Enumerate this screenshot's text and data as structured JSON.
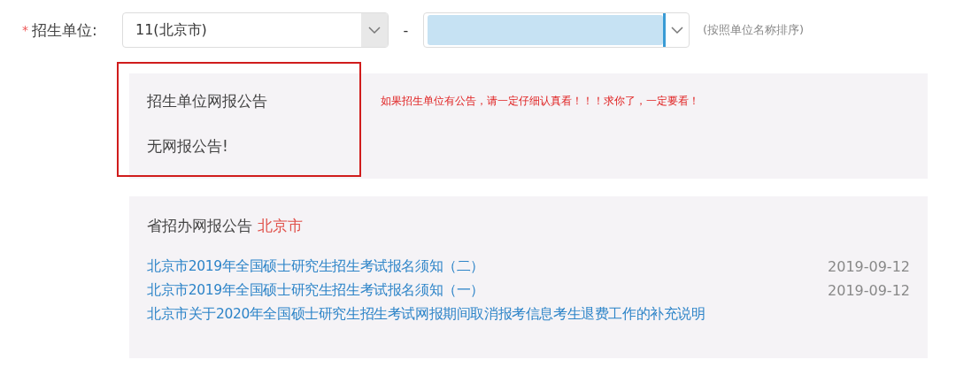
{
  "form": {
    "required_mark": "*",
    "label": "招生单位:",
    "province_select": {
      "value": "11(北京市)"
    },
    "separator": "-",
    "hint": "(按照单位名称排序)"
  },
  "unit_notice": {
    "title": "招生单位网报公告",
    "message": "无网报公告!",
    "annotation": "如果招生单位有公告，请一定仔细认真看！！！求你了，一定要看！",
    "highlighted": true
  },
  "province_notice": {
    "title": "省招办网报公告",
    "region": "北京市",
    "items": [
      {
        "title": "北京市2019年全国硕士研究生招生考试报名须知（二）",
        "date": "2019-09-12"
      },
      {
        "title": "北京市2019年全国硕士研究生招生考试报名须知（一）",
        "date": "2019-09-12"
      },
      {
        "title": "北京市关于2020年全国硕士研究生招生考试网报期间取消报考信息考生退费工作的补充说明"
      }
    ]
  }
}
